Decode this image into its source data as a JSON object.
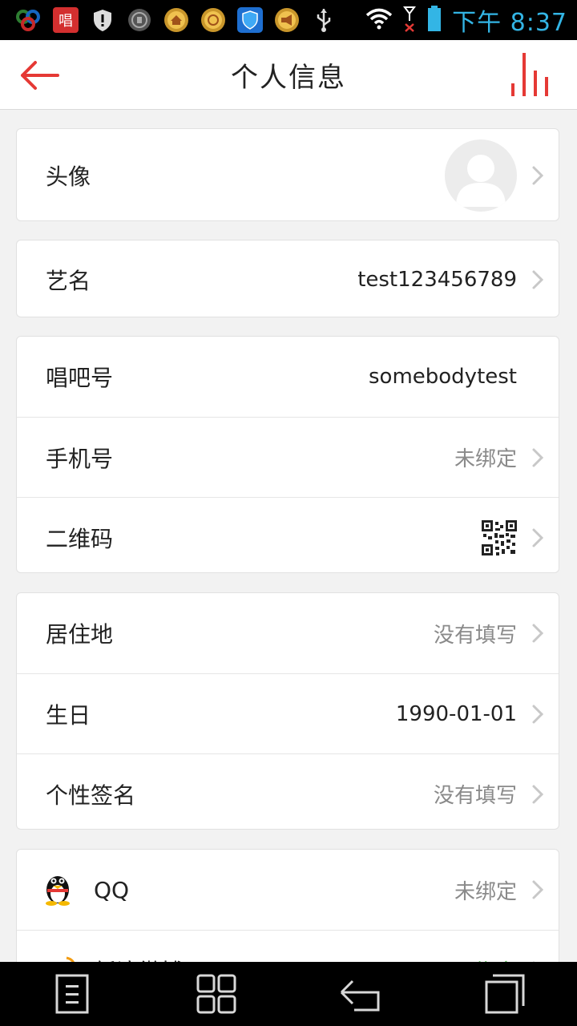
{
  "status_bar": {
    "time": "下午 8:37",
    "icons": [
      "app-circles-icon",
      "changba-icon",
      "shield-icon",
      "security-badge-icon",
      "home-coin-icon",
      "gold-coin-icon",
      "blue-shield-icon",
      "horn-coin-icon",
      "usb-icon"
    ],
    "accent_color": "#33b5e5"
  },
  "header": {
    "title": "个人信息",
    "accent_color": "#e53935"
  },
  "profile": {
    "avatar_label": "头像",
    "stage_name_label": "艺名",
    "stage_name_value": "test123456789",
    "changba_id_label": "唱吧号",
    "changba_id_value": "somebodytest",
    "phone_label": "手机号",
    "phone_value": "未绑定",
    "qrcode_label": "二维码",
    "residence_label": "居住地",
    "residence_value": "没有填写",
    "birthday_label": "生日",
    "birthday_value": "1990-01-01",
    "signature_label": "个性签名",
    "signature_value": "没有填写",
    "qq_label": "QQ",
    "qq_value": "未绑定",
    "weibo_label": "新浪微博",
    "weibo_value": "已绑定"
  },
  "nav": {
    "items": [
      "menu-icon",
      "apps-grid-icon",
      "back-arrow-icon",
      "recent-apps-icon"
    ]
  }
}
